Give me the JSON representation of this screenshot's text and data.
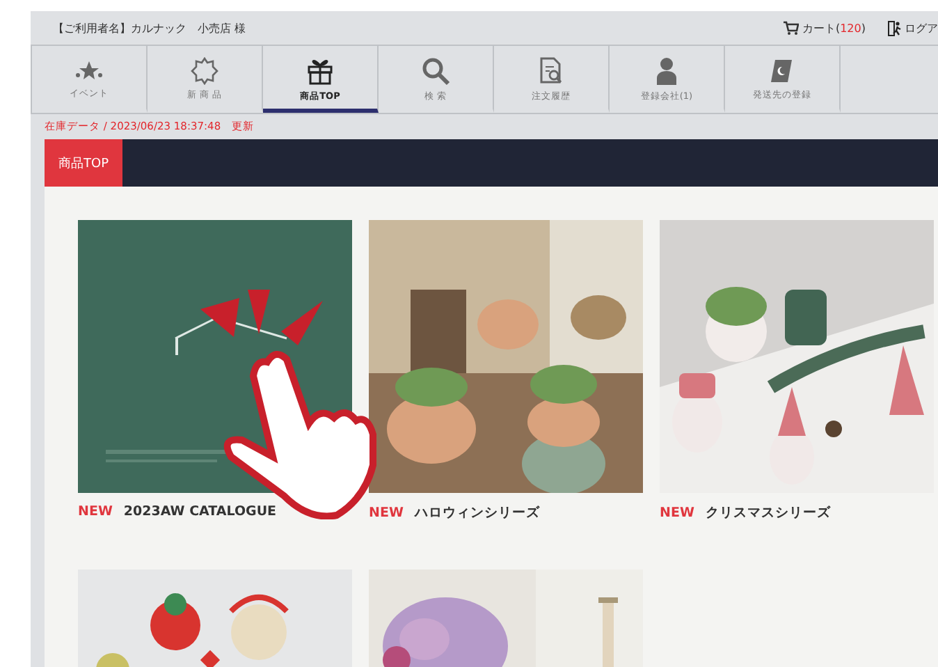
{
  "header": {
    "user": "【ご利用者名】カルナック　小売店 様",
    "cart": {
      "label": "カート(",
      "count": "120",
      "close": ")"
    },
    "logout": "ログア"
  },
  "nav": [
    {
      "label": "イベント",
      "kind": "event",
      "selected": false
    },
    {
      "label": "新 商 品",
      "kind": "new",
      "selected": false
    },
    {
      "label": "商品TOP",
      "kind": "gift",
      "selected": true
    },
    {
      "label": "検 索",
      "kind": "search",
      "selected": false
    },
    {
      "label": "注文履歴",
      "kind": "history",
      "selected": false
    },
    {
      "label": "登録会社(1)",
      "kind": "person",
      "selected": false
    },
    {
      "label": "発送先の登録",
      "kind": "book",
      "selected": false
    }
  ],
  "stock_update": "在庫データ / 2023/06/23 18:37:48　更新",
  "section_tab": "商品TOP",
  "products": [
    {
      "badge": "NEW",
      "title": "2023AW CATALOGUE",
      "kind": "catalogue"
    },
    {
      "badge": "NEW",
      "title": "ハロウィンシリーズ",
      "kind": "halloween"
    },
    {
      "badge": "NEW",
      "title": "クリスマスシリーズ",
      "kind": "christmas"
    },
    {
      "kind": "ornaments"
    },
    {
      "kind": "flowers"
    }
  ]
}
